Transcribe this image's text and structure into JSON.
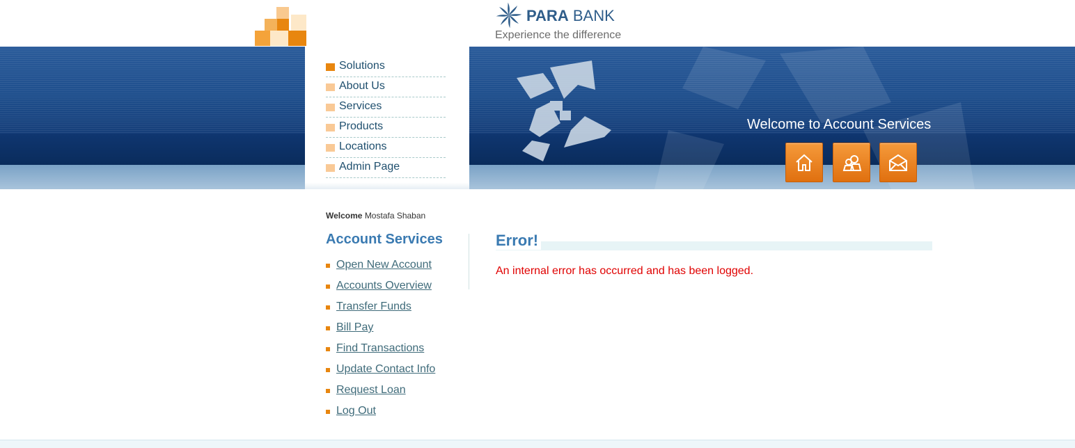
{
  "header": {
    "brand_bold": "PARA",
    "brand_rest": "BANK",
    "tagline": "Experience the difference",
    "logo_icon": "pinwheel-logo-icon"
  },
  "banner": {
    "welcome": "Welcome to Account Services",
    "buttons": [
      {
        "icon": "home-icon"
      },
      {
        "icon": "people-icon"
      },
      {
        "icon": "envelope-icon"
      }
    ]
  },
  "topnav": {
    "items": [
      {
        "label": "Solutions"
      },
      {
        "label": "About Us"
      },
      {
        "label": "Services"
      },
      {
        "label": "Products"
      },
      {
        "label": "Locations"
      },
      {
        "label": "Admin Page"
      }
    ]
  },
  "sidebar": {
    "welcome_label": "Welcome",
    "user_name": "Mostafa Shaban",
    "title": "Account Services",
    "links": [
      {
        "label": "Open New Account"
      },
      {
        "label": "Accounts Overview"
      },
      {
        "label": "Transfer Funds"
      },
      {
        "label": "Bill Pay"
      },
      {
        "label": "Find Transactions"
      },
      {
        "label": "Update Contact Info"
      },
      {
        "label": "Request Loan"
      },
      {
        "label": "Log Out"
      }
    ]
  },
  "main": {
    "title": "Error!",
    "message": "An internal error has occurred and has been logged."
  },
  "colors": {
    "accent_orange": "#e8860f",
    "title_blue": "#3a7ab1",
    "error_red": "#e00000"
  }
}
